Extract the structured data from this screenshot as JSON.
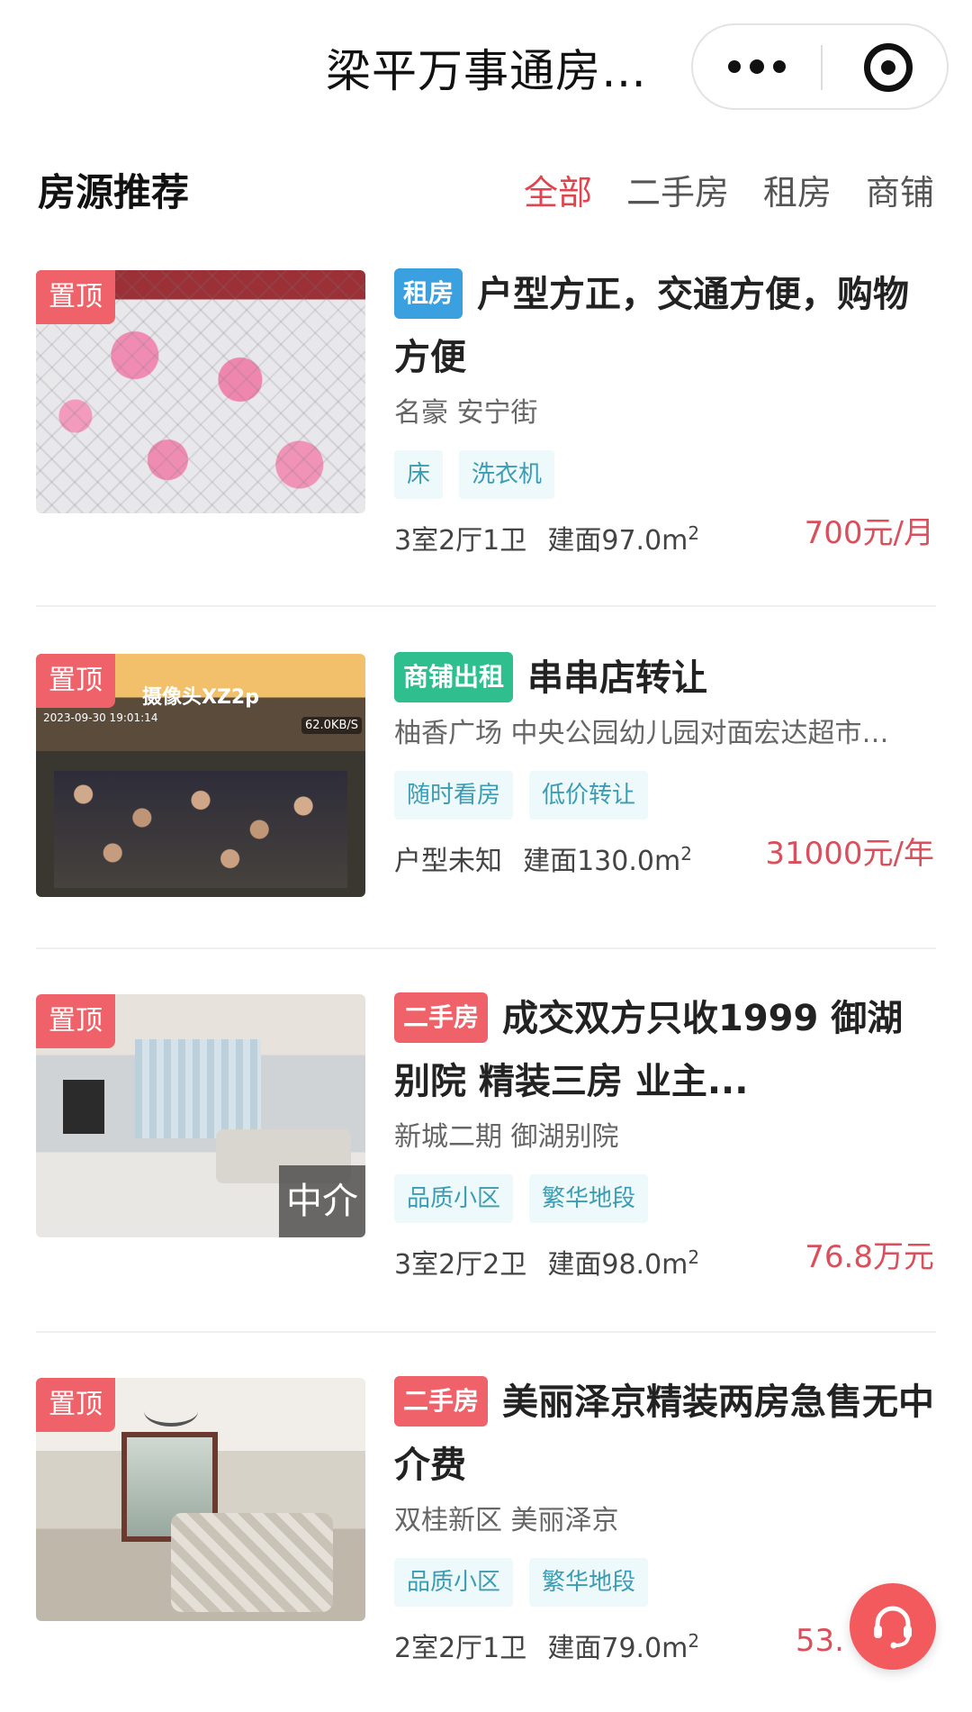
{
  "nav": {
    "title": "梁平万事通房…"
  },
  "section": {
    "title": "房源推荐",
    "filters": [
      "全部",
      "二手房",
      "租房",
      "商铺"
    ],
    "active_filter": "全部"
  },
  "pin_label": "置顶",
  "listings": [
    {
      "type_tag": "租房",
      "title": "户型方正，交通方便，购物方便",
      "address": "名豪 安宁街",
      "features": [
        "床",
        "洗衣机"
      ],
      "layout": "3室2厅1卫",
      "area": "建面97.0m",
      "area_sup": "2",
      "price": "700元/月"
    },
    {
      "type_tag": "商铺出租",
      "title": "串串店转让",
      "address": "柚香广场 中央公园幼儿园对面宏达超市…",
      "features": [
        "随时看房",
        "低价转让"
      ],
      "layout": "户型未知",
      "area": "建面130.0m",
      "area_sup": "2",
      "price": "31000元/年",
      "image_text": {
        "camera": "摄像头XZ2p",
        "timestamp": "2023-09-30 19:01:14",
        "speed": "62.0KB/S"
      }
    },
    {
      "type_tag": "二手房",
      "title": "成交双方只收1999 御湖别院 精装三房 业主...",
      "address": "新城二期 御湖别院",
      "features": [
        "品质小区",
        "繁华地段"
      ],
      "layout": "3室2厅2卫",
      "area": "建面98.0m",
      "area_sup": "2",
      "price": "76.8万元",
      "image_text": {
        "watermark": "中介"
      }
    },
    {
      "type_tag": "二手房",
      "title": "美丽泽京精装两房急售无中介费",
      "address": "双桂新区 美丽泽京",
      "features": [
        "品质小区",
        "繁华地段"
      ],
      "layout": "2室2厅1卫",
      "area": "建面79.0m",
      "area_sup": "2",
      "price": "53."
    }
  ],
  "colors": {
    "accent": "#e0444e",
    "rent_tag": "#3aa0e0",
    "shop_tag": "#2fbf8f",
    "used_tag": "#f06269",
    "price": "#d9505c",
    "feature_bg": "#eef9fb",
    "feature_text": "#3b9cb4"
  },
  "icons": {
    "more": "more-dots-icon",
    "close": "close-circle-icon",
    "service": "headset-icon"
  }
}
